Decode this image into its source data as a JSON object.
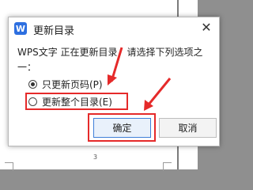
{
  "dialog": {
    "title": "更新目录",
    "app_icon_letter": "W",
    "close_symbol": "✕",
    "message": "WPS文字 正在更新目录，请选择下列选项之一：",
    "options": [
      {
        "label": "只更新页码(P)",
        "selected": true
      },
      {
        "label": "更新整个目录(E)",
        "selected": false
      }
    ],
    "ok_label": "确定",
    "cancel_label": "取消"
  },
  "document": {
    "page_number": "3"
  },
  "annotation_color": "#e52a2a",
  "accent_color": "#2d6fe0"
}
